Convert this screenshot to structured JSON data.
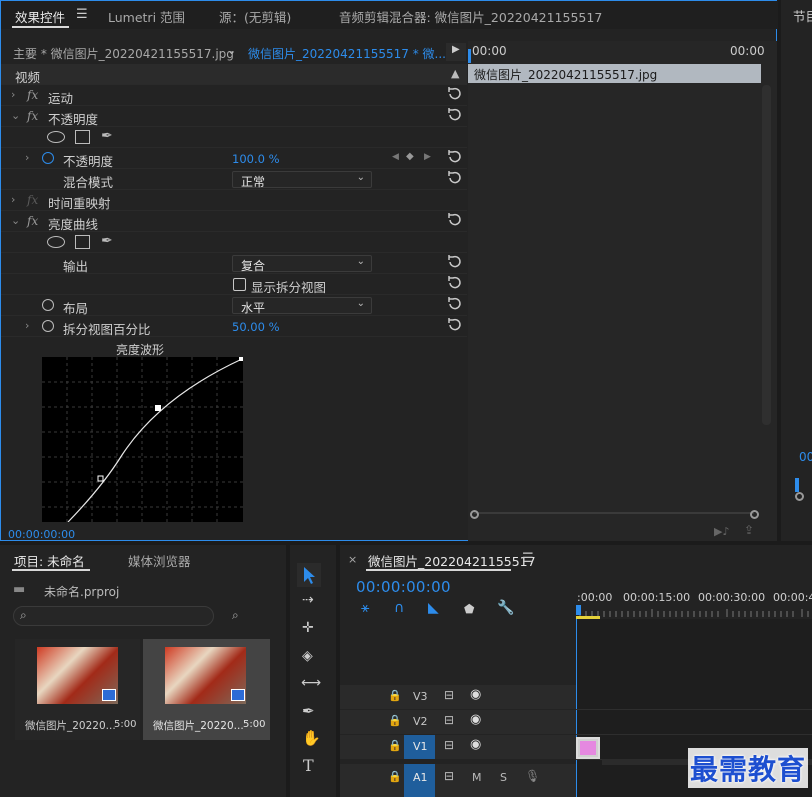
{
  "effect_controls": {
    "tabs": [
      {
        "label": "效果控件",
        "active": true,
        "menu_icon": "hamburger-icon"
      },
      {
        "label": "Lumetri 范围"
      },
      {
        "label": "源：(无剪辑)"
      },
      {
        "label": "音频剪辑混合器: 微信图片_20220421155517"
      },
      {
        "label": "节目"
      }
    ],
    "master_label": "主要 * 微信图片_20220421155517.jpg",
    "sequence_label": "微信图片_20220421155517 * 微...",
    "mini_timeline": {
      "start": "00:00",
      "end": "00:00",
      "clip_name": "微信图片_20220421155517.jpg"
    },
    "section_video": "视频",
    "rows": {
      "motion": "运动",
      "opacity": "不透明度",
      "opacity_param": "不透明度",
      "opacity_value": "100.0 %",
      "blend_mode": "混合模式",
      "blend_value": "正常",
      "time_remap": "时间重映射",
      "luma_curve": "亮度曲线",
      "output": "输出",
      "output_value": "复合",
      "show_split": "显示拆分视图",
      "layout": "布局",
      "layout_value": "水平",
      "split_percent": "拆分视图百分比",
      "split_value": "50.00 %",
      "waveform_title": "亮度波形"
    },
    "fx_label": "fx",
    "timecode": "00:00:00:00"
  },
  "project": {
    "tabs": [
      {
        "label": "项目: 未命名",
        "active": true
      },
      {
        "label": "媒体浏览器"
      }
    ],
    "project_file": "未命名.prproj",
    "items": [
      {
        "name": "微信图片_20220...",
        "duration": "5:00",
        "selected": false
      },
      {
        "name": "微信图片_20220...",
        "duration": "5:00",
        "selected": true
      }
    ]
  },
  "tools": [
    "selection-tool-icon",
    "track-select-tool-icon",
    "ripple-edit-tool-icon",
    "razor-tool-icon",
    "slip-tool-icon",
    "pen-tool-icon",
    "hand-tool-icon",
    "type-tool-icon"
  ],
  "timeline": {
    "close": "×",
    "tab_label": "微信图片_20220421155517",
    "menu": "☰",
    "timecode": "00:00:00:00",
    "ruler": [
      ":00:00",
      "00:00:15:00",
      "00:00:30:00",
      "00:00:4"
    ],
    "tracks": [
      {
        "name": "V3"
      },
      {
        "name": "V2"
      },
      {
        "name": "V1",
        "target": true
      },
      {
        "name": "A1",
        "target": true,
        "m": "M",
        "s": "S"
      }
    ]
  },
  "watermark": "最需教育",
  "colors": {
    "accent": "#2d8ceb",
    "panel": "#232323",
    "clip_pink": "#e588e0",
    "work_area": "#e5d23a"
  }
}
